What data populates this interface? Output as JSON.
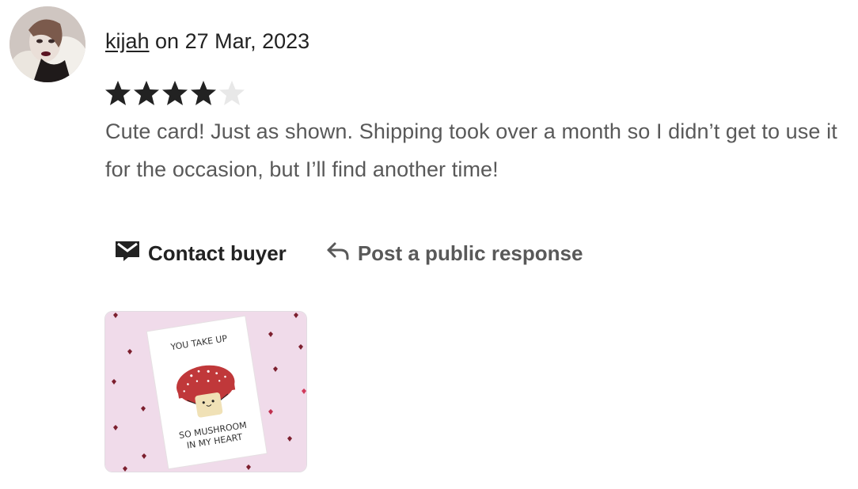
{
  "review": {
    "username": "kijah",
    "date_text": " on 27 Mar, 2023",
    "rating": 4,
    "max_rating": 5,
    "text": "Cute card! Just as shown. Shipping took over a month so I didn’t get to use it for the occasion, but I’ll find another time!",
    "star_color_filled": "#222222",
    "star_color_empty": "#e8e8e8"
  },
  "actions": {
    "contact_label": "Contact buyer",
    "respond_label": "Post a public response"
  },
  "photo": {
    "card_top_text": "YOU TAKE UP",
    "card_bottom_text_1": "SO MUSHROOM",
    "card_bottom_text_2": "IN MY HEART",
    "background_color": "#f0dbea",
    "cap_color": "#c0383a"
  }
}
